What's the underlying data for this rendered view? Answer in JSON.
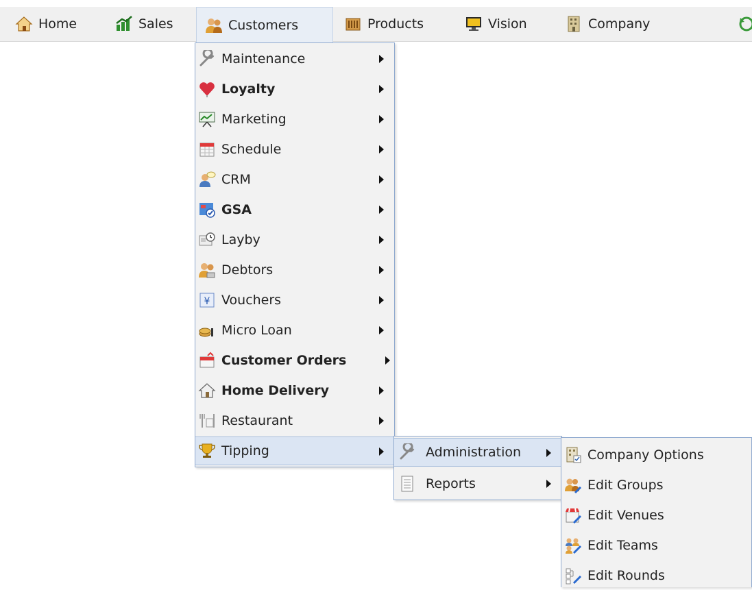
{
  "topnav": {
    "items": [
      {
        "label": "Home",
        "icon": "home-icon"
      },
      {
        "label": "Sales",
        "icon": "sales-chart-icon"
      },
      {
        "label": "Customers",
        "icon": "customers-icon"
      },
      {
        "label": "Products",
        "icon": "products-icon"
      },
      {
        "label": "Vision",
        "icon": "monitor-icon"
      },
      {
        "label": "Company",
        "icon": "building-icon"
      }
    ]
  },
  "customers_menu": {
    "items": [
      {
        "label": "Maintenance",
        "icon": "wrench-icon"
      },
      {
        "label": "Loyalty",
        "icon": "heart-icon"
      },
      {
        "label": "Marketing",
        "icon": "presentation-icon"
      },
      {
        "label": "Schedule",
        "icon": "calendar-icon"
      },
      {
        "label": "CRM",
        "icon": "person-chat-icon"
      },
      {
        "label": "GSA",
        "icon": "map-check-icon"
      },
      {
        "label": "Layby",
        "icon": "layby-clock-icon"
      },
      {
        "label": "Debtors",
        "icon": "debtors-icon"
      },
      {
        "label": "Vouchers",
        "icon": "voucher-icon"
      },
      {
        "label": "Micro Loan",
        "icon": "coins-icon"
      },
      {
        "label": "Customer Orders",
        "icon": "orders-calendar-icon"
      },
      {
        "label": "Home Delivery",
        "icon": "house-delivery-icon"
      },
      {
        "label": "Restaurant",
        "icon": "cutlery-icon"
      },
      {
        "label": "Tipping",
        "icon": "trophy-icon"
      }
    ]
  },
  "tipping_menu": {
    "items": [
      {
        "label": "Administration",
        "icon": "wrench-icon"
      },
      {
        "label": "Reports",
        "icon": "report-document-icon"
      }
    ]
  },
  "administration_menu": {
    "items": [
      {
        "label": "Company Options",
        "icon": "building-check-icon"
      },
      {
        "label": "Edit Groups",
        "icon": "group-edit-icon"
      },
      {
        "label": "Edit Venues",
        "icon": "venue-edit-icon"
      },
      {
        "label": "Edit Teams",
        "icon": "teams-edit-icon"
      },
      {
        "label": "Edit Rounds",
        "icon": "rounds-edit-icon"
      }
    ]
  },
  "colors": {
    "menu_border": "#8fa9cf",
    "menu_bg": "#f2f2f2",
    "highlight_bg": "#dbe5f3",
    "active_tab_bg": "#e8eef6"
  }
}
